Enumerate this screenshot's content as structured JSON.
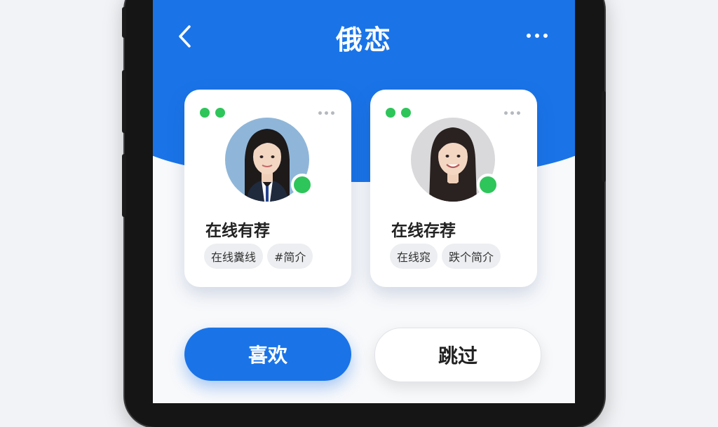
{
  "header": {
    "title": "俄恋",
    "back_icon": "chevron-left-icon",
    "more_icon": "more-horizontal-icon"
  },
  "cards": [
    {
      "name": "在线有荐",
      "tags": [
        "在线糞线",
        "#简介"
      ],
      "status": "online",
      "avatar_bg": "#8fb6d9"
    },
    {
      "name": "在线存荐",
      "tags": [
        "在线窕",
        "跌个简介"
      ],
      "status": "online",
      "avatar_bg": "#d9d9db"
    }
  ],
  "actions": {
    "like_label": "喜欢",
    "skip_label": "跳过"
  },
  "colors": {
    "primary": "#1a74e8",
    "online": "#2ec55a"
  }
}
